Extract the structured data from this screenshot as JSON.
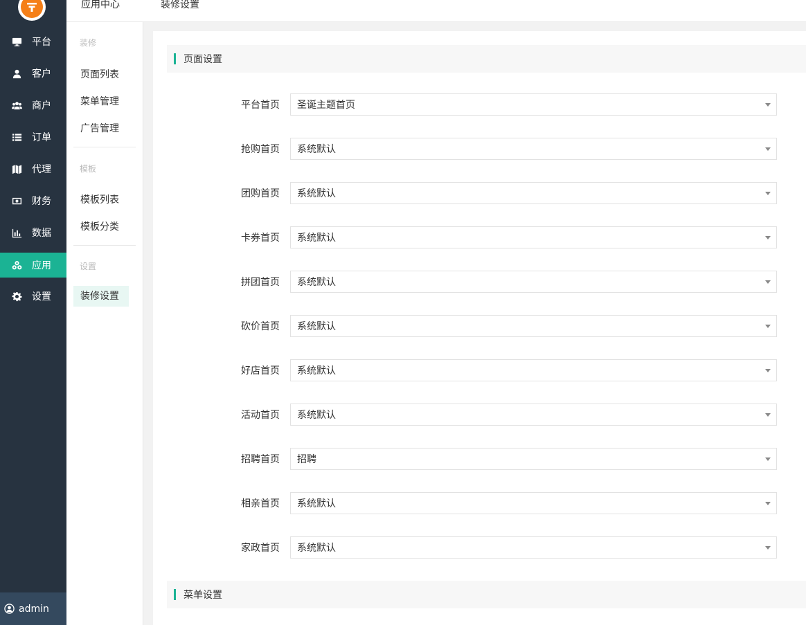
{
  "sidebar": {
    "items": [
      {
        "label": "平台",
        "icon": "monitor-icon"
      },
      {
        "label": "客户",
        "icon": "user-icon"
      },
      {
        "label": "商户",
        "icon": "users-icon"
      },
      {
        "label": "订单",
        "icon": "list-icon"
      },
      {
        "label": "代理",
        "icon": "map-icon"
      },
      {
        "label": "财务",
        "icon": "money-icon"
      },
      {
        "label": "数据",
        "icon": "bar-chart-icon"
      },
      {
        "label": "应用",
        "icon": "cubes-icon"
      },
      {
        "label": "设置",
        "icon": "gear-icon"
      }
    ],
    "active_index": 7,
    "user": "admin"
  },
  "topbar": {
    "tabs": [
      "应用中心",
      "装修设置"
    ]
  },
  "subnav": {
    "groups": [
      {
        "title": "装修",
        "items": [
          "页面列表",
          "菜单管理",
          "广告管理"
        ]
      },
      {
        "title": "模板",
        "items": [
          "模板列表",
          "模板分类"
        ]
      },
      {
        "title": "设置",
        "items": [
          "装修设置"
        ]
      }
    ]
  },
  "main": {
    "section1_title": "页面设置",
    "section2_title": "菜单设置",
    "rows": [
      {
        "label": "平台首页",
        "value": "圣诞主题首页"
      },
      {
        "label": "抢购首页",
        "value": "系统默认"
      },
      {
        "label": "团购首页",
        "value": "系统默认"
      },
      {
        "label": "卡券首页",
        "value": "系统默认"
      },
      {
        "label": "拼团首页",
        "value": "系统默认"
      },
      {
        "label": "砍价首页",
        "value": "系统默认"
      },
      {
        "label": "好店首页",
        "value": "系统默认"
      },
      {
        "label": "活动首页",
        "value": "系统默认"
      },
      {
        "label": "招聘首页",
        "value": "招聘"
      },
      {
        "label": "相亲首页",
        "value": "系统默认"
      },
      {
        "label": "家政首页",
        "value": "系统默认"
      }
    ]
  },
  "colors": {
    "sidebar_bg": "#273340",
    "accent": "#1bb394",
    "logo": "#f57f17"
  }
}
